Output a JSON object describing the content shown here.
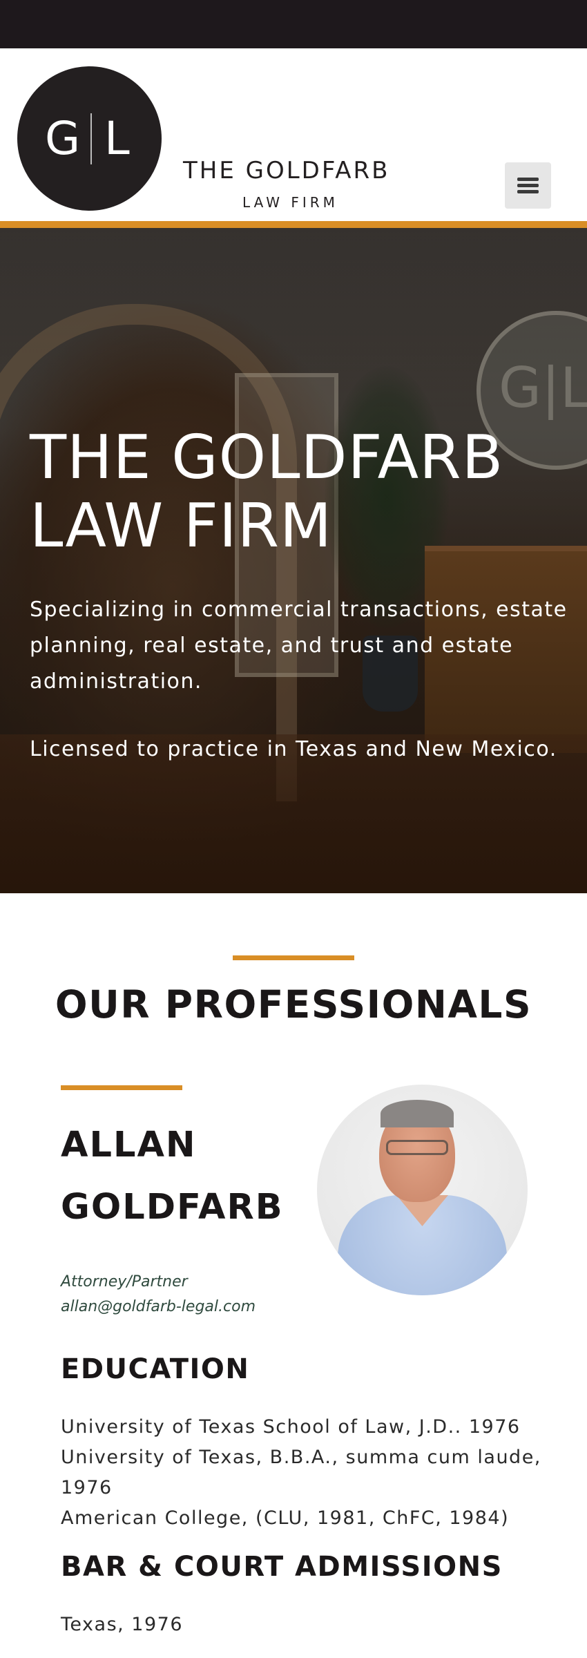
{
  "header": {
    "logo_left": "G",
    "logo_right": "L",
    "brand_name": "THE GOLDFARB",
    "brand_sub": "LAW FIRM",
    "menu_icon": "hamburger-menu-icon"
  },
  "hero": {
    "title": "THE GOLDFARB LAW FIRM",
    "paragraph1": "Specializing in commercial transactions, estate planning, real estate, and trust and estate administration.",
    "paragraph2": "Licensed to practice in Texas and New Mexico.",
    "wall_logo": "G|L"
  },
  "professionals": {
    "section_title": "OUR PROFESSIONALS",
    "name": "ALLAN GOLDFARB",
    "role": "Attorney/Partner",
    "email": "allan@goldfarb-legal.com",
    "education_heading": "EDUCATION",
    "education": [
      "University of Texas School of Law, J.D.. 1976",
      "University of Texas, B.B.A., summa cum laude, 1976",
      "American College, (CLU, 1981, ChFC, 1984)"
    ],
    "bar_heading": "BAR & COURT ADMISSIONS",
    "bar_admissions": [
      "Texas, 1976"
    ]
  },
  "colors": {
    "accent": "#d98e26",
    "dark": "#1e181c",
    "text": "#1a1718"
  }
}
